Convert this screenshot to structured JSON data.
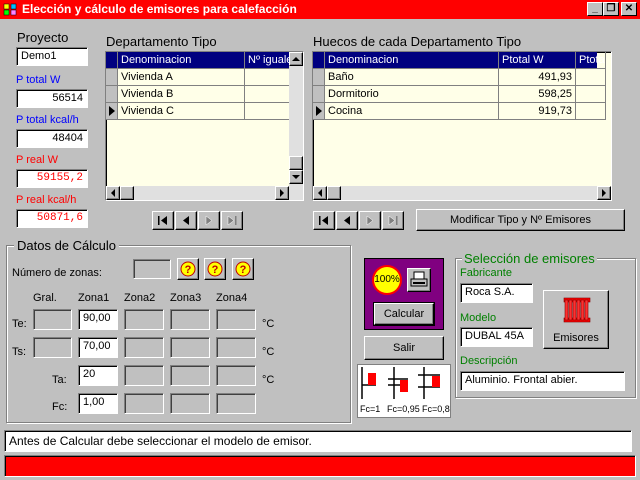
{
  "window": {
    "title": "Elección y cálculo de emisores para calefacción",
    "colors": {
      "titlebar": "#ff0000",
      "status_bar": "#ff0000",
      "grid_header": "#000080",
      "grid_bg": "#ffffe8"
    }
  },
  "left_panel": {
    "proyecto_label": "Proyecto",
    "proyecto_value": "Demo1",
    "ptotal_w_label": "P total W",
    "ptotal_w_value": "56514",
    "ptotal_kcal_label": "P total kcal/h",
    "ptotal_kcal_value": "48404",
    "preal_w_label": "P real W",
    "preal_w_value": "59155,2",
    "preal_kcal_label": "P real kcal/h",
    "preal_kcal_value": "50871,6"
  },
  "departamento_grid": {
    "title": "Departamento Tipo",
    "columns": [
      "Denominacion",
      "Nº iguale"
    ],
    "rows": [
      {
        "denominacion": "Vivienda A",
        "iguales": ""
      },
      {
        "denominacion": "Vivienda B",
        "iguales": ""
      },
      {
        "denominacion": "Vivienda C",
        "iguales": ""
      }
    ],
    "current_row": 2
  },
  "huecos_grid": {
    "title": "Huecos de cada Departamento Tipo",
    "columns": [
      "Denominacion",
      "Ptotal W",
      "Ptota"
    ],
    "rows": [
      {
        "denominacion": "Baño",
        "ptotal_w": "491,93"
      },
      {
        "denominacion": "Dormitorio",
        "ptotal_w": "598,25"
      },
      {
        "denominacion": "Cocina",
        "ptotal_w": "919,73"
      }
    ],
    "current_row": 2
  },
  "modificar_button": "Modificar Tipo y Nº Emisores",
  "datos_calculo": {
    "title": "Datos de Cálculo",
    "num_zonas_label": "Número de zonas:",
    "num_zonas_value": "",
    "columns": [
      "Gral.",
      "Zona1",
      "Zona2",
      "Zona3",
      "Zona4"
    ],
    "rows": [
      {
        "label": "Te:",
        "gral": "",
        "zona1": "90,00",
        "unit": "°C"
      },
      {
        "label": "Ts:",
        "gral": "",
        "zona1": "70,00",
        "unit": "°C"
      },
      {
        "label": "Ta:",
        "zona1": "20",
        "unit": "°C"
      },
      {
        "label": "Fc:",
        "zona1": "1,00",
        "unit": ""
      }
    ]
  },
  "calc_panel": {
    "badge": "100%",
    "calcular_label": "Calcular",
    "salir_label": "Salir",
    "fc_labels": [
      "Fc=1",
      "Fc=0,95",
      "Fc=0,8"
    ]
  },
  "seleccion": {
    "title": "Selección de emisores",
    "fabricante_label": "Fabricante",
    "fabricante_value": "Roca S.A.",
    "modelo_label": "Modelo",
    "modelo_value": "DUBAL 45A",
    "descripcion_label": "Descripción",
    "descripcion_value": "Aluminio. Frontal abier.",
    "emisores_label": "Emisores"
  },
  "status_message": "Antes de Calcular debe seleccionar el modelo de emisor."
}
